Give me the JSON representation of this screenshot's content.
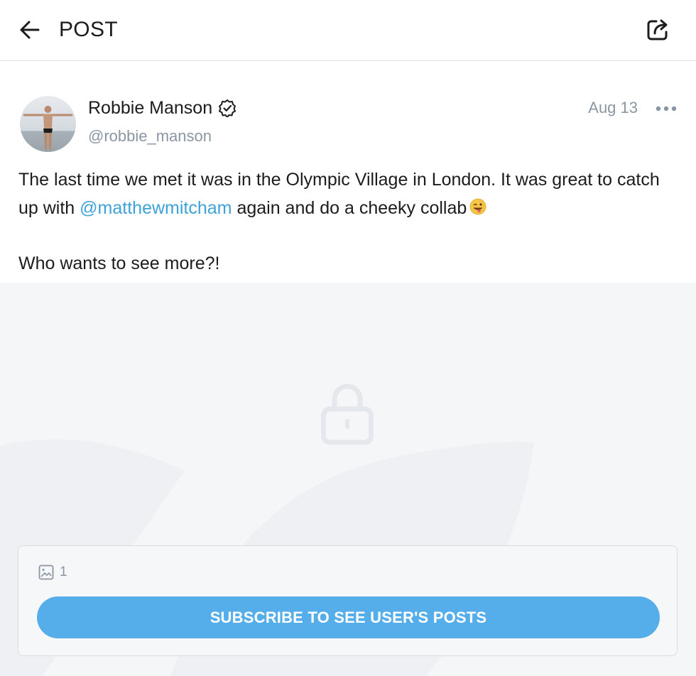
{
  "header": {
    "title": "POST",
    "back_icon": "arrow-left-icon",
    "share_icon": "share-icon"
  },
  "post": {
    "author_name": "Robbie Manson",
    "verified_icon": "verified-badge-icon",
    "handle": "@robbie_manson",
    "date": "Aug 13",
    "more_icon": "more-dots-icon",
    "text_part1": "The last time we met it was in the Olympic Village in London. It was great to catch up with ",
    "mention": "@matthewmitcham",
    "text_part2": " again and do a cheeky collab",
    "emoji_icon": "winking-tongue-emoji-icon",
    "text_part3": "Who wants to see more?!"
  },
  "locked": {
    "lock_icon": "lock-icon",
    "media_icon": "image-icon",
    "media_count": "1",
    "subscribe_label": "SUBSCRIBE TO SEE USER'S POSTS"
  },
  "colors": {
    "accent": "#55aeea",
    "mention": "#3ea1d7",
    "muted": "#8a96a3",
    "locked_bg": "#f5f6f8"
  }
}
